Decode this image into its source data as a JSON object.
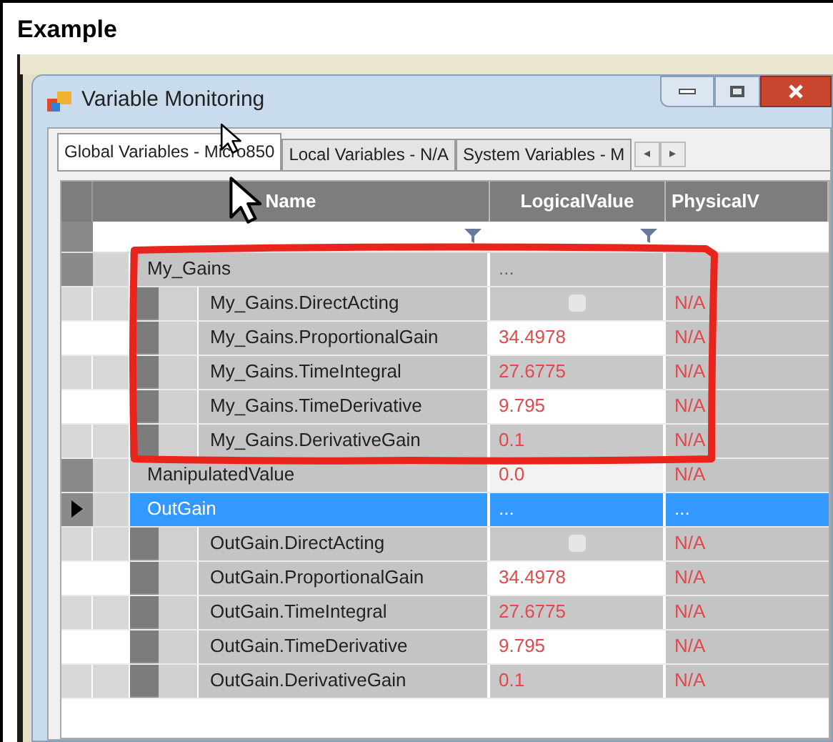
{
  "heading": "Example",
  "window": {
    "title": "Variable Monitoring"
  },
  "tabs": [
    {
      "label": "Global Variables - Micro850",
      "selected": true
    },
    {
      "label": "Local Variables - N/A",
      "selected": false
    },
    {
      "label": "System Variables - M",
      "selected": false
    }
  ],
  "tab_scroll": [
    "◂",
    "▸"
  ],
  "table": {
    "columns": [
      "Name",
      "LogicalValue",
      "PhysicalV"
    ],
    "rows": [
      {
        "name": "My_Gains",
        "logical": "...",
        "selected": false,
        "children": [
          {
            "name": "My_Gains.DirectActing",
            "kind": "bool",
            "checked": false,
            "physical": "N/A"
          },
          {
            "name": "My_Gains.ProportionalGain",
            "kind": "value",
            "logical": "34.4978",
            "physical": "N/A"
          },
          {
            "name": "My_Gains.TimeIntegral",
            "kind": "value",
            "logical": "27.6775",
            "physical": "N/A"
          },
          {
            "name": "My_Gains.TimeDerivative",
            "kind": "value",
            "logical": "9.795",
            "physical": "N/A"
          },
          {
            "name": "My_Gains.DerivativeGain",
            "kind": "value",
            "logical": "0.1",
            "physical": "N/A"
          }
        ]
      },
      {
        "name": "ManipulatedValue",
        "logical": "0.0",
        "physical": "N/A",
        "selected": false
      },
      {
        "name": "OutGain",
        "logical": "...",
        "physical": "...",
        "selected": true,
        "children": [
          {
            "name": "OutGain.DirectActing",
            "kind": "bool",
            "checked": false,
            "physical": "N/A"
          },
          {
            "name": "OutGain.ProportionalGain",
            "kind": "value",
            "logical": "34.4978",
            "physical": "N/A"
          },
          {
            "name": "OutGain.TimeIntegral",
            "kind": "value",
            "logical": "27.6775",
            "physical": "N/A"
          },
          {
            "name": "OutGain.TimeDerivative",
            "kind": "value",
            "logical": "9.795",
            "physical": "N/A"
          },
          {
            "name": "OutGain.DerivativeGain",
            "kind": "value",
            "logical": "0.1",
            "physical": "N/A"
          }
        ]
      }
    ]
  }
}
